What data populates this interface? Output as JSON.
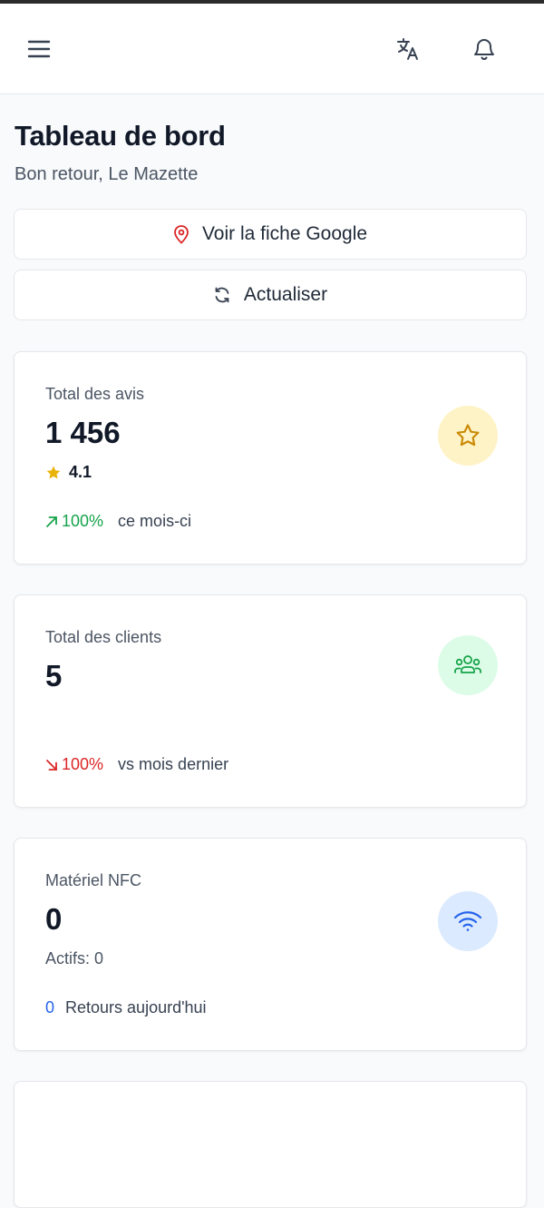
{
  "header": {
    "menu_icon": "hamburger-icon",
    "language_icon": "translate-icon",
    "notifications_icon": "bell-icon"
  },
  "page": {
    "title": "Tableau de bord",
    "subtitle": "Bon retour, Le Mazette"
  },
  "actions": {
    "google_label": "Voir la fiche Google",
    "google_icon": "map-pin-icon",
    "refresh_label": "Actualiser",
    "refresh_icon": "refresh-icon"
  },
  "cards": {
    "reviews": {
      "label": "Total des avis",
      "value": "1 456",
      "rating": "4.1",
      "trend_pct": "100%",
      "trend_direction": "up",
      "trend_note": "ce mois-ci",
      "icon": "star-icon",
      "icon_bg": "#fef3c7",
      "icon_color": "#ca8a04"
    },
    "clients": {
      "label": "Total des clients",
      "value": "5",
      "trend_pct": "100%",
      "trend_direction": "down",
      "trend_note": "vs mois dernier",
      "icon": "users-icon",
      "icon_bg": "#dcfce7",
      "icon_color": "#16a34a"
    },
    "nfc": {
      "label": "Matériel NFC",
      "value": "0",
      "active_line": "Actifs: 0",
      "returns_count": "0",
      "returns_label": "Retours aujourd'hui",
      "icon": "wifi-icon",
      "icon_bg": "#dbeafe",
      "icon_color": "#2563eb"
    }
  },
  "colors": {
    "trend_up": "#16a34a",
    "trend_down": "#dc2626",
    "link_blue": "#2563eb",
    "pin_red": "#dc2626"
  }
}
